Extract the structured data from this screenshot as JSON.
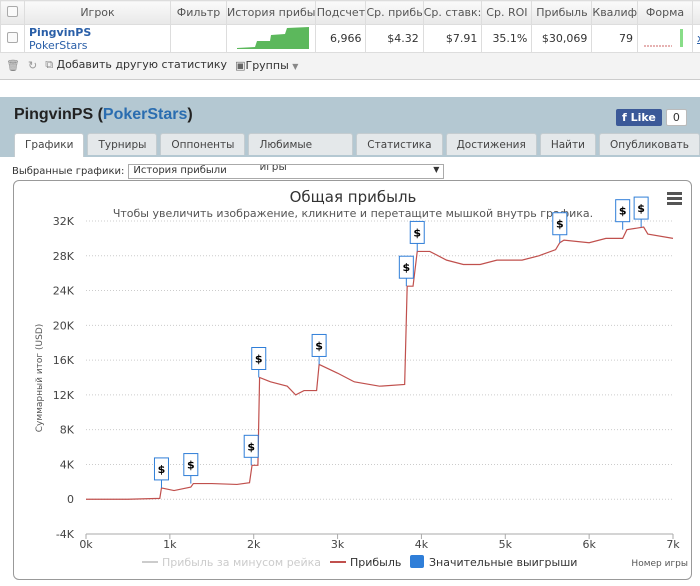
{
  "table": {
    "headers": [
      "Игрок",
      "Фильтр",
      "История прибы",
      "Подсчет",
      "Ср. прибь",
      "Ср. ставк:",
      "Ср. ROI",
      "Прибыль",
      "Квалиф",
      "Форма"
    ],
    "row": {
      "player": "PingvinPS",
      "site": "PokerStars",
      "filter": "",
      "count": "6,966",
      "avg_profit": "$4.32",
      "avg_stake": "$7.91",
      "avg_roi": "35.1%",
      "profit": "$30,069",
      "qualif": "79",
      "extra": "x"
    }
  },
  "toolbar": {
    "add_stat": "Добавить другую статистику",
    "groups": "Группы"
  },
  "profile": {
    "name": "PingvinPS",
    "site": "PokerStars",
    "like_label": "Like",
    "like_count": "0"
  },
  "tabs": [
    "Графики",
    "Турниры",
    "Оппоненты",
    "Любимые игры",
    "Статистика",
    "Достижения",
    "Найти",
    "Опубликовать"
  ],
  "selector": {
    "label": "Выбранные графики:",
    "value": "История прибыли"
  },
  "chart_data": {
    "type": "line",
    "title": "Общая прибыль",
    "subtitle": "Чтобы увеличить изображение, кликните и перетащите мышкой внутрь графика.",
    "xlabel": "Номер игры",
    "ylabel": "Суммарный итог (USD)",
    "xlim": [
      0,
      7000
    ],
    "ylim": [
      -4000,
      32000
    ],
    "xticks": [
      "0k",
      "1k",
      "2k",
      "3k",
      "4k",
      "5k",
      "6k",
      "7k"
    ],
    "yticks": [
      "-4K",
      "0",
      "4K",
      "8K",
      "12K",
      "16K",
      "20K",
      "24K",
      "28K",
      "32K"
    ],
    "grid": true,
    "legend": "bottom",
    "series": [
      {
        "name": "Прибыль за минусом рейка",
        "color": "#cccccc",
        "visible": false
      },
      {
        "name": "Прибыль",
        "color": "#c0504d",
        "points": [
          [
            0,
            0
          ],
          [
            500,
            0
          ],
          [
            880,
            100
          ],
          [
            900,
            1300
          ],
          [
            950,
            1200
          ],
          [
            1050,
            1000
          ],
          [
            1100,
            1100
          ],
          [
            1250,
            1400
          ],
          [
            1280,
            1800
          ],
          [
            1500,
            1800
          ],
          [
            1800,
            1700
          ],
          [
            1950,
            1900
          ],
          [
            1980,
            3900
          ],
          [
            2050,
            3900
          ],
          [
            2070,
            14000
          ],
          [
            2200,
            13500
          ],
          [
            2400,
            13000
          ],
          [
            2500,
            12000
          ],
          [
            2600,
            12500
          ],
          [
            2750,
            12500
          ],
          [
            2780,
            15500
          ],
          [
            3000,
            14500
          ],
          [
            3200,
            13500
          ],
          [
            3500,
            13000
          ],
          [
            3800,
            13200
          ],
          [
            3830,
            24500
          ],
          [
            3900,
            24500
          ],
          [
            3950,
            28500
          ],
          [
            4100,
            28500
          ],
          [
            4300,
            27500
          ],
          [
            4500,
            27000
          ],
          [
            4700,
            27000
          ],
          [
            4900,
            27500
          ],
          [
            5200,
            27500
          ],
          [
            5400,
            28000
          ],
          [
            5600,
            28700
          ],
          [
            5650,
            29500
          ],
          [
            5700,
            29800
          ],
          [
            6000,
            29500
          ],
          [
            6200,
            30000
          ],
          [
            6400,
            30000
          ],
          [
            6450,
            31000
          ],
          [
            6650,
            31300
          ],
          [
            6700,
            30500
          ],
          [
            7000,
            30000
          ]
        ]
      },
      {
        "name": "Значительные выигрыши",
        "color": "#2f7ed8",
        "flag": "$",
        "points": [
          [
            900,
            1300
          ],
          [
            1250,
            1800
          ],
          [
            1970,
            3900
          ],
          [
            2060,
            14000
          ],
          [
            2780,
            15500
          ],
          [
            3820,
            24500
          ],
          [
            3950,
            28500
          ],
          [
            5650,
            29500
          ],
          [
            6400,
            31000
          ],
          [
            6620,
            31300
          ]
        ]
      }
    ]
  }
}
